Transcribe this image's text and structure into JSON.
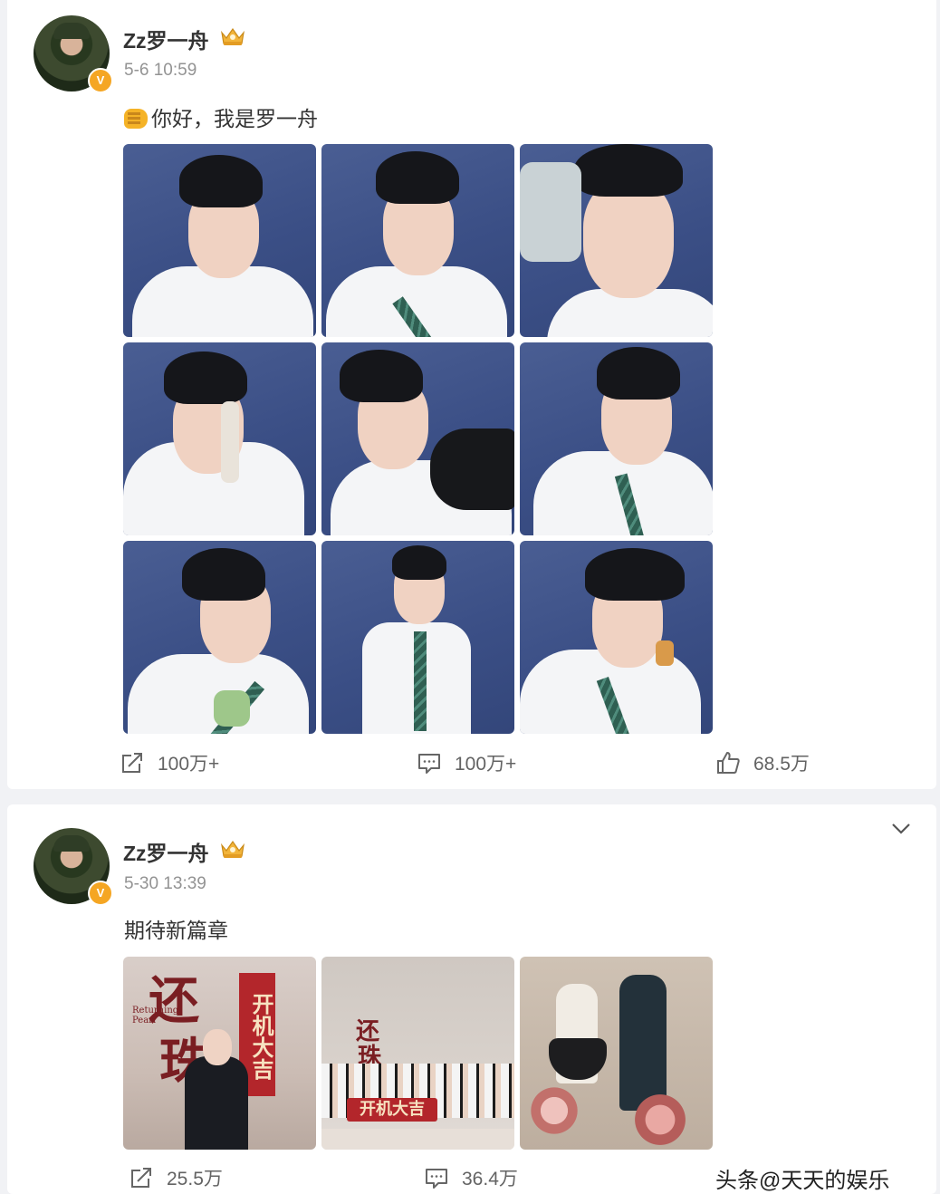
{
  "posts": [
    {
      "user": "Zz罗一舟",
      "time": "5-6 10:59",
      "text": "你好，我是罗一舟",
      "image_count": 9,
      "repost_count": "100万+",
      "comment_count": "100万+",
      "like_count": "68.5万"
    },
    {
      "user": "Zz罗一舟",
      "time": "5-30 13:39",
      "text": "期待新篇章",
      "image_count": 3,
      "repost_count": "25.5万",
      "comment_count": "36.4万",
      "poster": {
        "title_a": "还",
        "title_b": "珠",
        "subtitle": "Returning Pearl",
        "banner": "开机大吉"
      }
    }
  ],
  "watermark": "头条@天天的娱乐",
  "icons": {
    "verified": "verified-v-badge-icon",
    "crown": "crown-badge-icon",
    "repost": "repost-icon",
    "comment": "comment-icon",
    "like": "thumbs-up-icon",
    "more": "chevron-down-icon"
  },
  "colors": {
    "page_bg": "#f1f2f5",
    "card_bg": "#ffffff",
    "badge": "#f5a623",
    "meta": "#939393"
  }
}
